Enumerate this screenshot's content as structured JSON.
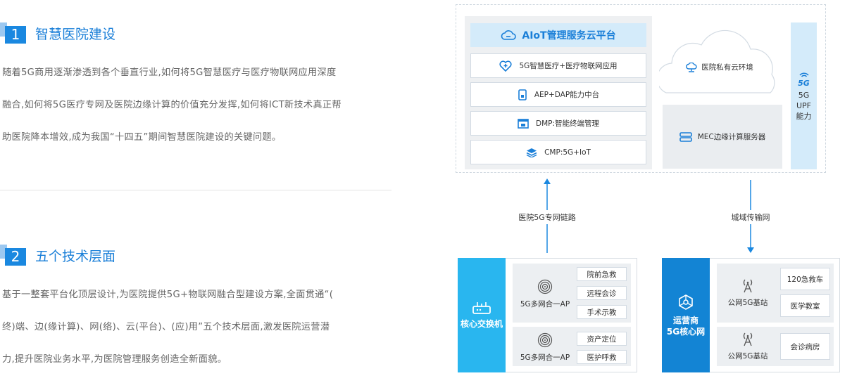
{
  "sections": [
    {
      "number": "1",
      "title": "智慧医院建设",
      "lines": [
        "随着5G商用逐渐渗透到各个垂直行业,如何将5G智慧医疗与医疗物联网应用深度",
        "融合,如何将5G医疗专网及医院边缘计算的价值充分发挥,如何将ICT新技术真正帮",
        "助医院降本增效,成为我国“十四五”期间智慧医院建设的关键问题。"
      ]
    },
    {
      "number": "2",
      "title": "五个技术层面",
      "lines": [
        "基于一整套平台化顶层设计,为医院提供5G+物联网融合型建设方案,全面贯通“(",
        "终)端、边(缘计算)、网(络)、云(平台)、(应)用”五个技术层面,激发医院运营潜",
        "力,提升医院业务水平,为医院管理服务创造全新面貌。"
      ]
    }
  ],
  "diagram": {
    "cloud_platform_title": "AIoT管理服务云平台",
    "apps": [
      {
        "label": "5G智慧医疗+医疗物联网应用",
        "icon": "medical-shield-icon"
      },
      {
        "label": "AEP+DAP能力中台",
        "icon": "phone-icon"
      },
      {
        "label": "DMP:智能终端管理",
        "icon": "device-manager-icon"
      },
      {
        "label": "CMP:5G+IoT",
        "icon": "layers-icon"
      }
    ],
    "private_cloud_label": "医院私有云环境",
    "mec_label": "MEC边缘计算服务器",
    "upf_badge": "5G",
    "upf_lines": [
      "5G",
      "UPF",
      "能力"
    ],
    "left_link_label": "医院5G专网链路",
    "right_link_label": "城域传输网",
    "core_switch_label": "核心交换机",
    "operator_lines": [
      "运营商",
      "5G核心网"
    ],
    "ap_groups": [
      {
        "ap_label": "5G多网合一AP",
        "items": [
          "院前急救",
          "远程会诊",
          "手术示教"
        ]
      },
      {
        "ap_label": "5G多网合一AP",
        "items": [
          "资产定位",
          "医护呼救"
        ]
      }
    ],
    "station_groups": [
      {
        "station_label": "公网5G基站",
        "items": [
          "120急救车",
          "医学教室"
        ]
      },
      {
        "station_label": "公网5G基站",
        "items": [
          "会诊病房"
        ]
      }
    ],
    "colors": {
      "accent": "#1a88e0",
      "light_blue": "#d4ebfa",
      "core_switch_bg": "#29b6ef",
      "operator_bg": "#1384d4"
    }
  }
}
